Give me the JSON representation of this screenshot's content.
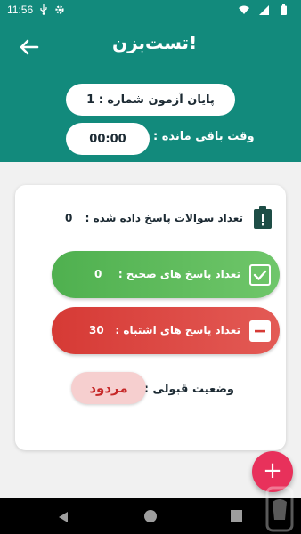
{
  "status_bar": {
    "time": "11:56",
    "icons": [
      "usb-icon",
      "gear-icon",
      "wifi-icon",
      "signal-icon",
      "battery-icon"
    ]
  },
  "header": {
    "app_title": "تست‌بزن!",
    "exam_label": "پایان آزمون شماره : 1",
    "time_remaining_label": "وقت باقی مانده :",
    "time_remaining_value": "00:00",
    "background_color": "#128a7c"
  },
  "results": {
    "answered_label": "تعداد سوالات پاسخ داده شده :",
    "answered_value": "0",
    "correct_label": "تعداد پاسخ های صحیح :",
    "correct_value": "0",
    "wrong_label": "تعداد پاسخ های اشتباه :",
    "wrong_value": "30",
    "acceptance_label": "وضعیت قبولی :",
    "acceptance_value": "مردود",
    "correct_color": "#4fb04f",
    "wrong_color": "#d63a35",
    "rejected_color": "#c62828"
  },
  "fab": {
    "label": "+",
    "color": "#e8315b"
  },
  "nav_bar": {
    "icons": [
      "back-triangle-icon",
      "home-circle-icon",
      "recents-square-icon"
    ]
  }
}
